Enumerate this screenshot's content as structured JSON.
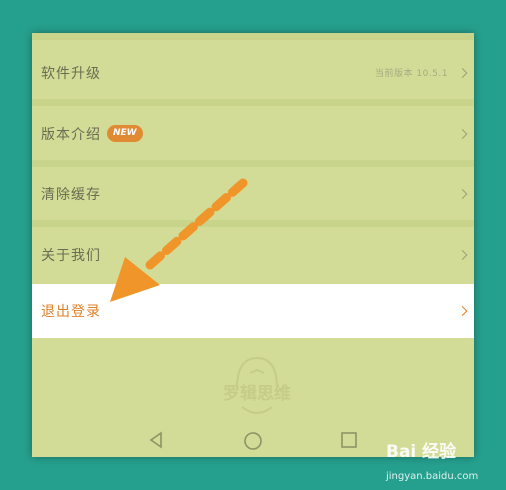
{
  "settings": {
    "upgrade_label": "软件升级",
    "version_text": "当前版本 10.5.1",
    "intro_label": "版本介绍",
    "new_badge": "NEW",
    "cache_label": "清除缓存",
    "about_label": "关于我们",
    "logout_label": "退出登录"
  },
  "logo_text": "罗辑思维",
  "watermark": {
    "brand": "Bai 经验",
    "url": "jingyan.baidu.com"
  },
  "colors": {
    "background": "#26a08e",
    "screen": "#d3dc96",
    "accent": "#e0812a",
    "arrow": "#f0952a"
  },
  "icons": {
    "back": "triangle-left-icon",
    "home": "circle-icon",
    "recent": "square-icon"
  }
}
